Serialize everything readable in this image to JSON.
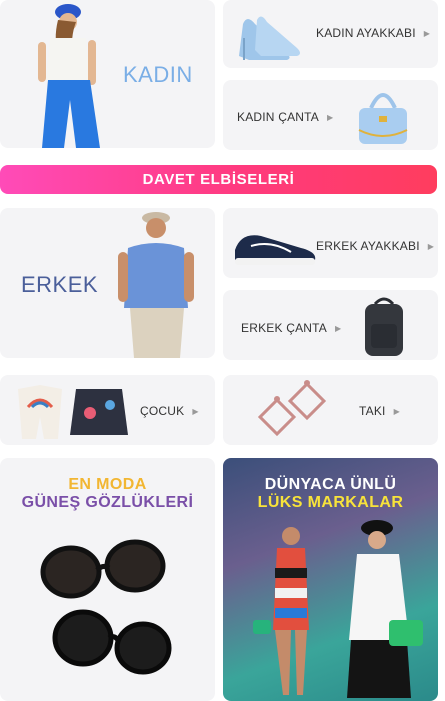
{
  "kadin": {
    "title": "KADIN"
  },
  "kadin_ayakkabi": {
    "label": "KADIN AYAKKABI"
  },
  "kadin_canta": {
    "label": "KADIN ÇANTA"
  },
  "banner": {
    "label": "DAVET ELBİSELERİ"
  },
  "erkek": {
    "title": "ERKEK"
  },
  "erkek_ayakkabi": {
    "label": "ERKEK AYAKKABI"
  },
  "erkek_canta": {
    "label": "ERKEK ÇANTA"
  },
  "cocuk": {
    "label": "ÇOCUK"
  },
  "taki": {
    "label": "TAKI"
  },
  "gozluk": {
    "line1": "EN MODA",
    "line2": "GÜNEŞ GÖZLÜKLERİ"
  },
  "luks": {
    "line1": "DÜNYACA ÜNLÜ",
    "line2": "LÜKS MARKALAR"
  },
  "colors": {
    "kadin_title": "#7aaee6",
    "erkek_title": "#4b5f9a",
    "gozluk_line1": "#f2b632",
    "gozluk_line2": "#7a4fa8",
    "luks_line2": "#f8e33a",
    "banner_start": "#ff4bb8",
    "banner_end": "#ff3d5e"
  },
  "icons": {
    "arrow": "triangle-right-icon"
  }
}
